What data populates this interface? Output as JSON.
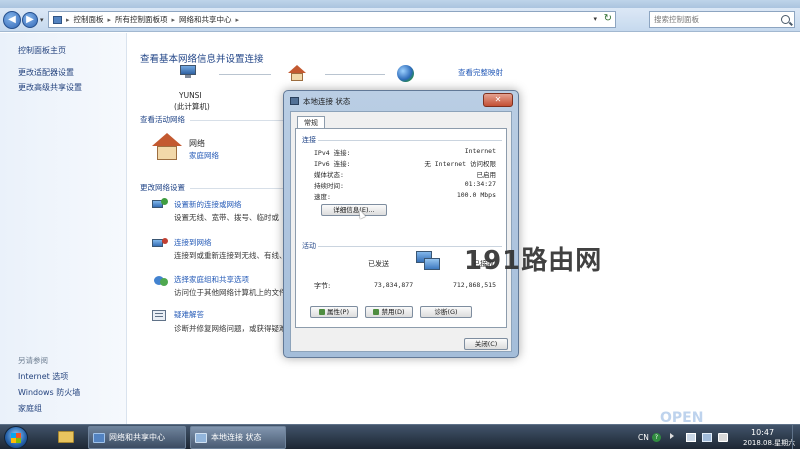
{
  "address_bar": {
    "crumbs": [
      "控制面板",
      "所有控制面板项",
      "网络和共享中心"
    ],
    "search_placeholder": "搜索控制面板"
  },
  "left_pane": {
    "links": [
      "控制面板主页",
      "更改适配器设置",
      "更改高级共享设置"
    ],
    "see_also_heading": "另请参阅",
    "see_also": [
      "Internet 选项",
      "Windows 防火墙",
      "家庭组"
    ]
  },
  "main": {
    "title": "查看基本网络信息并设置连接",
    "full_map_link": "查看完整映射",
    "computer_name": "YUNSI",
    "computer_sub": "(此计算机)",
    "active_heading": "查看活动网络",
    "network_name": "网络",
    "network_type": "家庭网络",
    "change_heading": "更改网络设置",
    "tasks": [
      {
        "title": "设置新的连接或网络",
        "desc": "设置无线、宽带、拨号、临时或"
      },
      {
        "title": "连接到网络",
        "desc": "连接到或重新连接到无线、有线、"
      },
      {
        "title": "选择家庭组和共享选项",
        "desc": "访问位于其他网络计算机上的文件"
      },
      {
        "title": "疑难解答",
        "desc": "诊断并修复网络问题，或获得疑难"
      }
    ]
  },
  "dialog": {
    "title": "本地连接 状态",
    "tab": "常规",
    "connection_heading": "连接",
    "rows": [
      {
        "key": "IPv4 连接:",
        "value": "Internet"
      },
      {
        "key": "IPv6 连接:",
        "value": "无 Internet 访问权限"
      },
      {
        "key": "媒体状态:",
        "value": "已启用"
      },
      {
        "key": "持续时间:",
        "value": "01:34:27"
      },
      {
        "key": "速度:",
        "value": "100.0 Mbps"
      }
    ],
    "details_button": "详细信息(E)...",
    "activity_heading": "活动",
    "sent_label": "已发送",
    "received_label": "已接收",
    "bytes_label": "字节:",
    "bytes_sent": "73,834,877",
    "bytes_received": "712,868,515",
    "properties_button": "属性(P)",
    "disable_button": "禁用(D)",
    "diagnose_button": "诊断(G)",
    "close_button": "关闭(C)"
  },
  "watermark": "191路由网",
  "taskbar": {
    "tasks": [
      "网络和共享中心",
      "本地连接 状态"
    ],
    "lang": "CN",
    "time": "10:47",
    "date": "2018.08.星期六"
  },
  "colors": {
    "accent_link": "#1d55b5",
    "heading": "#1a3f84",
    "taskbar": "#16202d"
  }
}
